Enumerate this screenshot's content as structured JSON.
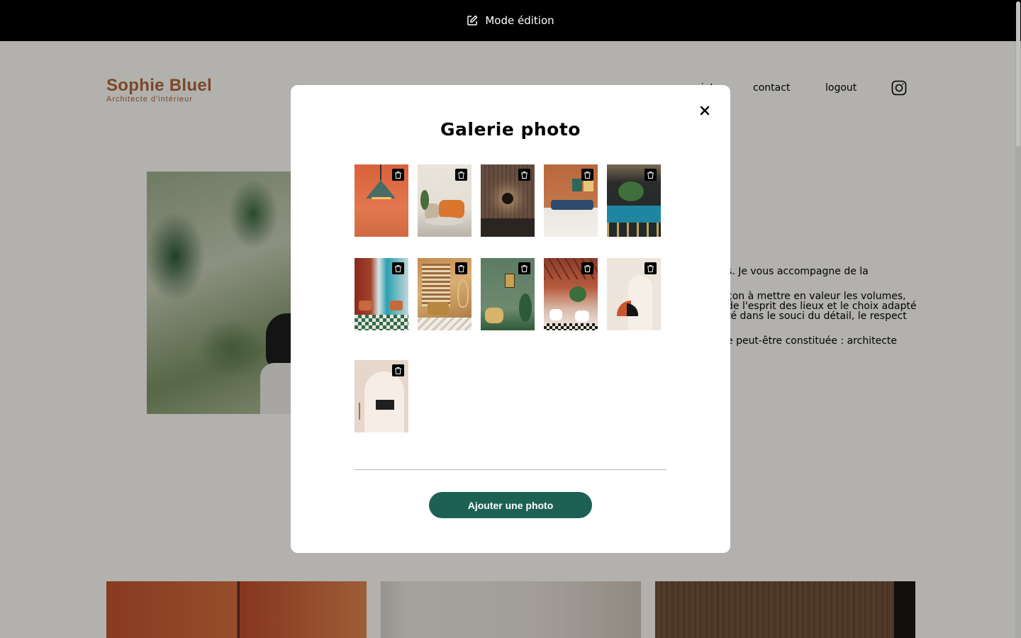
{
  "edit_bar": {
    "label": "Mode édition",
    "icon": "edit-icon"
  },
  "brand": {
    "title": "Sophie Bluel",
    "subtitle": "Architecte d'intérieur",
    "color": "#b1663c"
  },
  "nav": {
    "items": [
      {
        "label": "projets"
      },
      {
        "label": "contact"
      },
      {
        "label": "logout"
      }
    ],
    "instagram_icon": "instagram-icon"
  },
  "intro": {
    "paragraphs": [
      "s. Je vous accompagne de la",
      "çon à mettre en valeur les volumes,\nde l'esprit des lieux et le choix adapté\nré dans le souci du détail, le respect",
      "e peut-être constituée : architecte"
    ]
  },
  "modal": {
    "title": "Galerie photo",
    "close_icon": "close-icon",
    "add_button": "Ajouter une photo",
    "photos": [
      {
        "subject": "pendant-lamp-orange-wall"
      },
      {
        "subject": "living-room-orange-armchair"
      },
      {
        "subject": "wood-panel-wall-lamp"
      },
      {
        "subject": "orange-wall-sofa"
      },
      {
        "subject": "bar-blue-stools"
      },
      {
        "subject": "long-corridor-restaurant"
      },
      {
        "subject": "sunlit-chair-screen"
      },
      {
        "subject": "green-living-room"
      },
      {
        "subject": "terracotta-restaurant"
      },
      {
        "subject": "beige-arches-wall"
      },
      {
        "subject": "white-arch-bench"
      }
    ],
    "trash_icon": "trash-icon"
  },
  "colors": {
    "accent": "#1d6154",
    "brand": "#b1663c",
    "overlay": "rgba(0,0,0,0.3)"
  }
}
